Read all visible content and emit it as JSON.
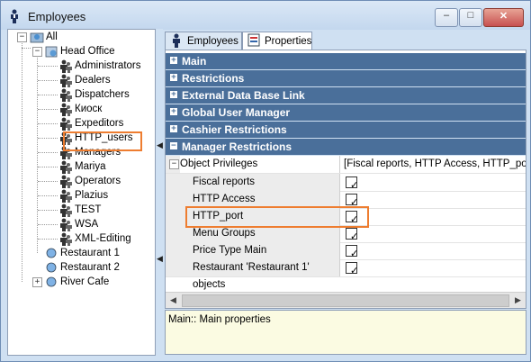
{
  "window": {
    "title": "Employees"
  },
  "tree": {
    "root": "All",
    "head_office": "Head Office",
    "groups": [
      "Administrators",
      "Dealers",
      "Dispatchers",
      "Киоск",
      "Expeditors",
      "HTTP_users",
      "Managers",
      "Mariya",
      "Operators",
      "Plazius",
      "TEST",
      "WSA",
      "XML-Editing"
    ],
    "restaurants": [
      "Restaurant 1",
      "Restaurant 2",
      "River Cafe"
    ]
  },
  "tabs": [
    {
      "label": "Employees"
    },
    {
      "label": "Properties"
    }
  ],
  "categories": [
    "Main",
    "Restrictions",
    "External Data Base Link",
    "Global User Manager",
    "Cashier Restrictions",
    "Manager Restrictions"
  ],
  "property": {
    "name": "Object Privileges",
    "value": "[Fiscal reports, HTTP Access, HTTP_port, Menu Groups, Price Type Main, Restaurant 'Restaurant 1' objects]",
    "items": [
      {
        "label": "Fiscal reports",
        "checked": true
      },
      {
        "label": "HTTP Access",
        "checked": true
      },
      {
        "label": "HTTP_port",
        "checked": true
      },
      {
        "label": "Menu Groups",
        "checked": true
      },
      {
        "label": "Price Type Main",
        "checked": true
      },
      {
        "label": "Restaurant 'Restaurant 1' objects",
        "checked": true
      }
    ]
  },
  "description": "Main:: Main properties",
  "glyphs": {
    "minimize": "–",
    "maximize": "□",
    "close": "✕",
    "expand_plus": "+",
    "collapse_minus": "−",
    "tick": "✓",
    "left_arrow": "◀",
    "right_arrow": "▶"
  },
  "colors": {
    "category_bar": "#4a6f9a",
    "highlight": "#ee7d30",
    "description_bg": "#fbfbe2"
  }
}
